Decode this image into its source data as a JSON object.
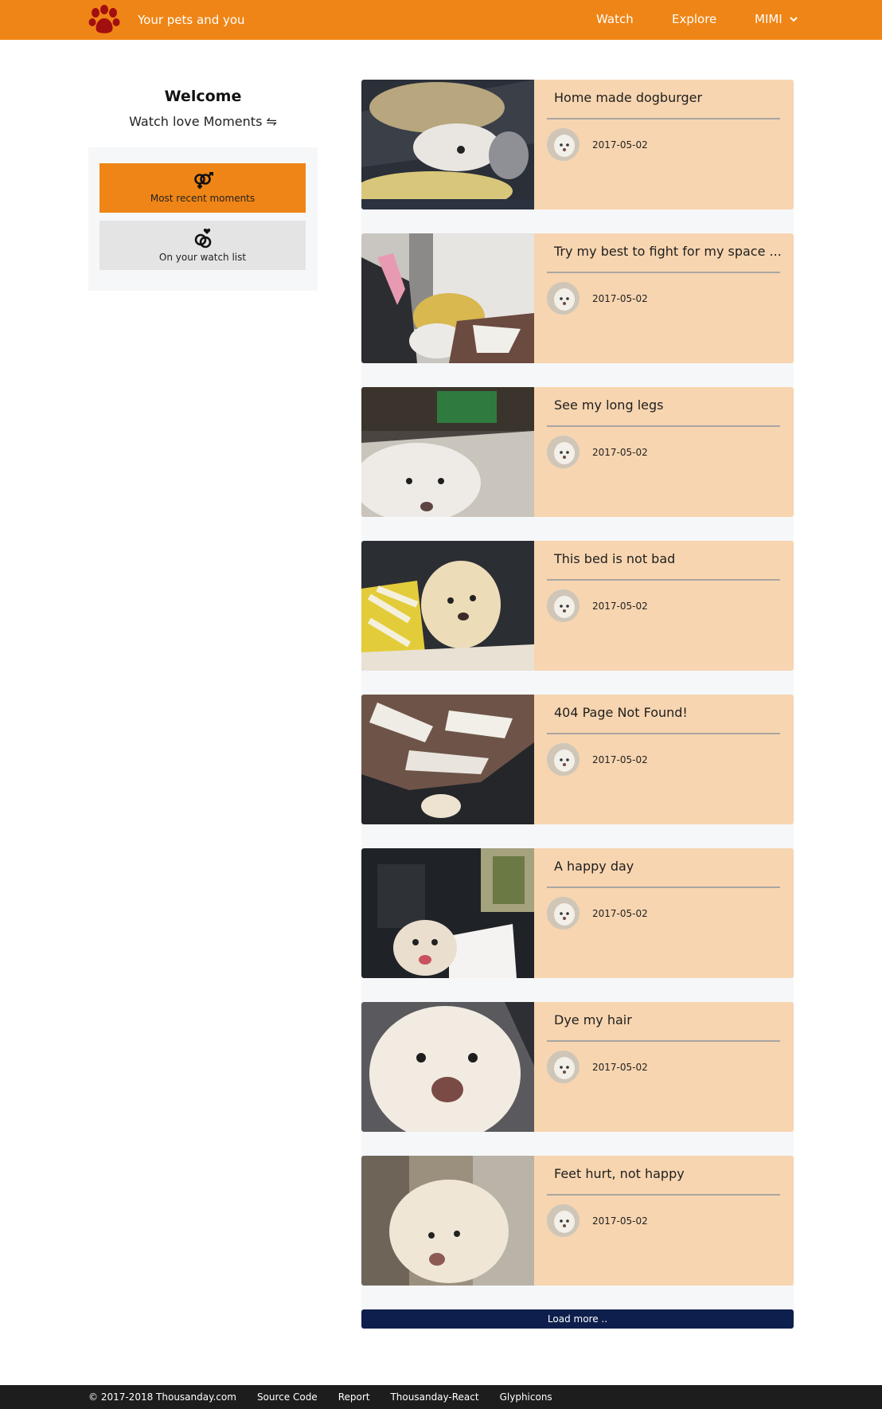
{
  "header": {
    "brand": "Your pets and you",
    "logo_icon": "paw-icon",
    "nav": {
      "watch": "Watch",
      "explore": "Explore",
      "user": "MIMI"
    },
    "colors": {
      "bar": "#ef8516",
      "logo": "#a30f0f"
    }
  },
  "sidebar": {
    "title": "Welcome",
    "subtitle": "Watch love Moments ⇋",
    "buttons": [
      {
        "label": "Most recent moments",
        "icon": "gender-symbols-icon",
        "active": true
      },
      {
        "label": "On your watch list",
        "icon": "linked-rings-icon",
        "active": false
      }
    ]
  },
  "feed": {
    "moments": [
      {
        "title": "Home made dogburger",
        "date": "2017-05-02"
      },
      {
        "title": "Try my best to fight for my space ...",
        "date": "2017-05-02"
      },
      {
        "title": "See my long legs",
        "date": "2017-05-02"
      },
      {
        "title": "This bed is not bad",
        "date": "2017-05-02"
      },
      {
        "title": "404 Page Not Found!",
        "date": "2017-05-02"
      },
      {
        "title": "A happy day",
        "date": "2017-05-02"
      },
      {
        "title": "Dye my hair",
        "date": "2017-05-02"
      },
      {
        "title": "Feet hurt, not happy",
        "date": "2017-05-02"
      }
    ],
    "load_more": "Load more .."
  },
  "footer": {
    "copyright": "© 2017-2018 Thousanday.com",
    "links": [
      "Source Code",
      "Report",
      "Thousanday-React",
      "Glyphicons"
    ]
  }
}
